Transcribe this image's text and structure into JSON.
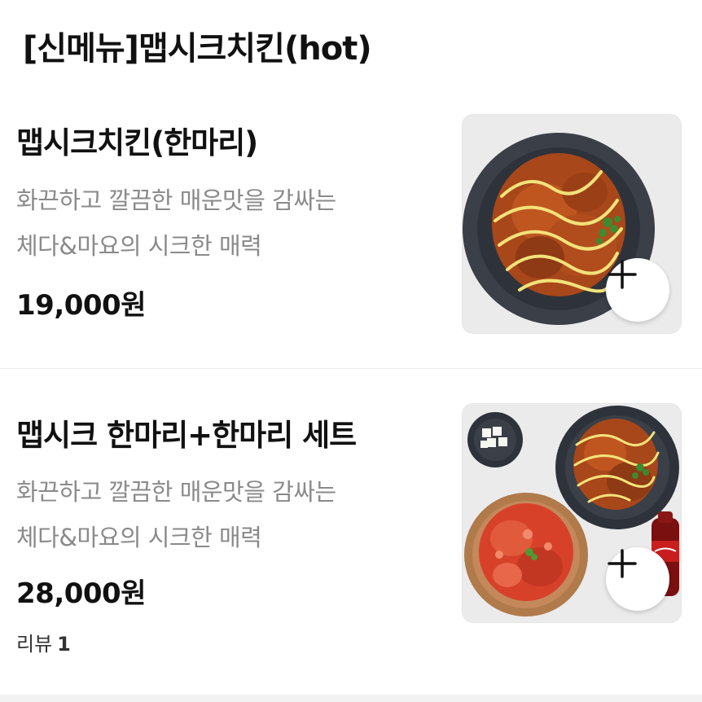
{
  "section": {
    "title": "[신메뉴]맵시크치킨(hot)"
  },
  "items": [
    {
      "name": "맵시크치킨(한마리)",
      "desc_line1": "화끈하고 깔끔한 매운맛을 감싸는",
      "desc_line2": "체다&마요의 시크한 매력",
      "price": "19,000원",
      "image": "spicy-chicken-plate"
    },
    {
      "name": "맵시크 한마리+한마리 세트",
      "desc_line1": "화끈하고 깔끔한 매운맛을 감싸는",
      "desc_line2": "체다&마요의 시크한 매력",
      "price": "28,000원",
      "review_label": "리뷰",
      "review_count": "1",
      "image": "chicken-set-platter"
    }
  ],
  "icons": {
    "add": "plus-icon"
  },
  "colors": {
    "text_primary": "#111111",
    "text_secondary": "#8a8a8a",
    "divider": "#ededed",
    "thumb_bg": "#ececec"
  }
}
